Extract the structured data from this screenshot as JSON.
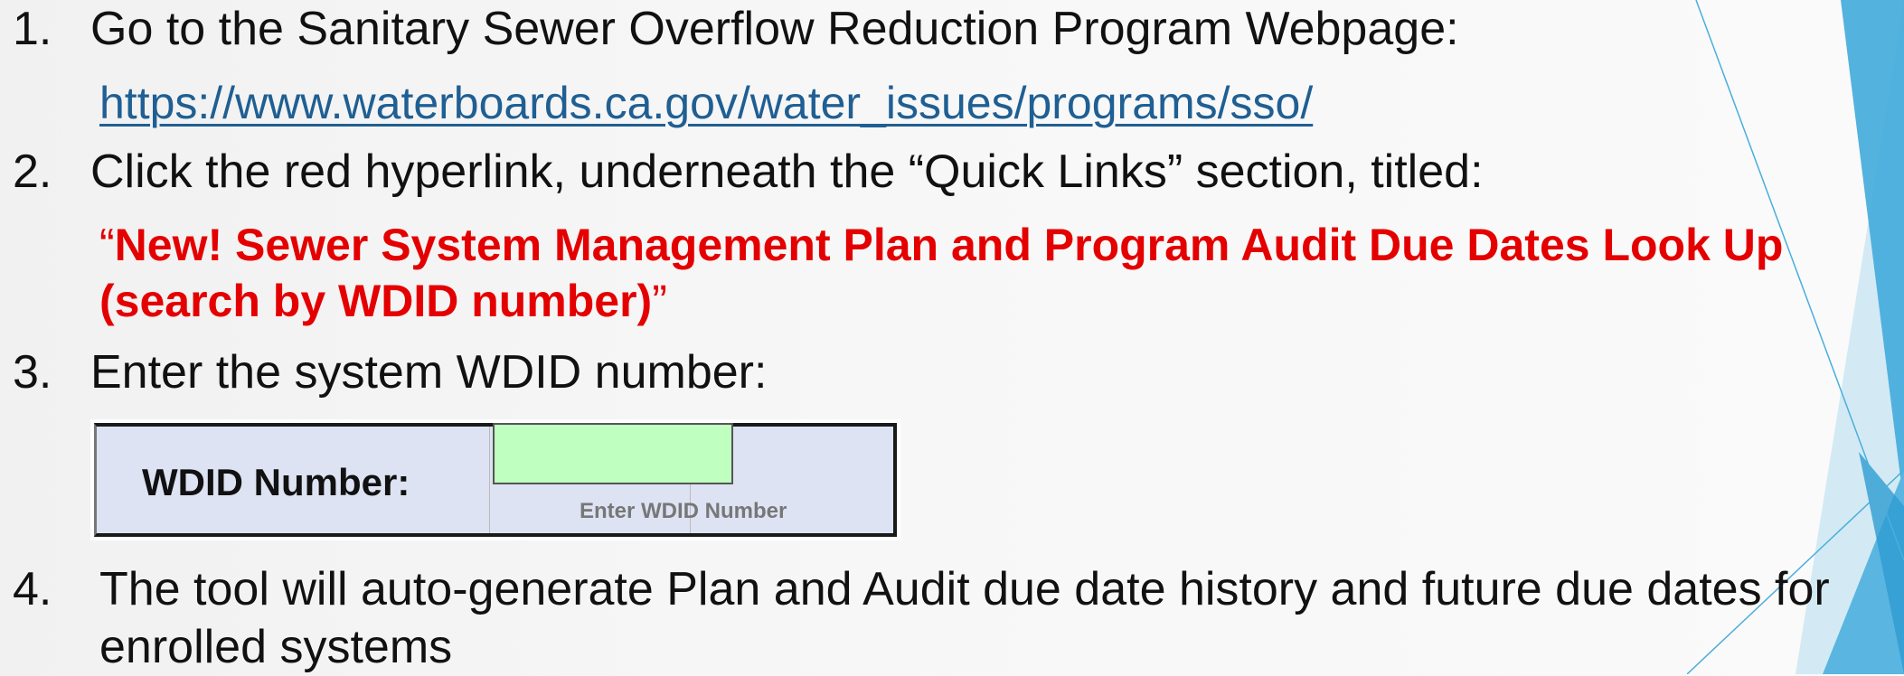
{
  "steps": [
    {
      "num": "1.",
      "text": "Go to the Sanitary Sewer Overflow Reduction Program Webpage:"
    },
    {
      "num": "2.",
      "text": "Click the red hyperlink, underneath the “Quick Links” section, titled:"
    },
    {
      "num": "3.",
      "text": "Enter the system WDID number:"
    },
    {
      "num": "4.",
      "text_line1": "The tool will auto-generate Plan and Audit due date history and future due dates for",
      "text_line2": "enrolled systems"
    }
  ],
  "link_url": "https://www.waterboards.ca.gov/water_issues/programs/sso/",
  "red_link": {
    "open_quote": "“",
    "line1": "New! Sewer System Management Plan and Program Audit Due Dates Look Up",
    "line2": "(search by WDID number)",
    "close_quote": "”"
  },
  "wdid": {
    "label": "WDID Number:",
    "hint": "Enter WDID Number",
    "input_value": ""
  },
  "colors": {
    "link": "#1f5f93",
    "red": "#e40000",
    "accent": "#3fa9d8"
  }
}
